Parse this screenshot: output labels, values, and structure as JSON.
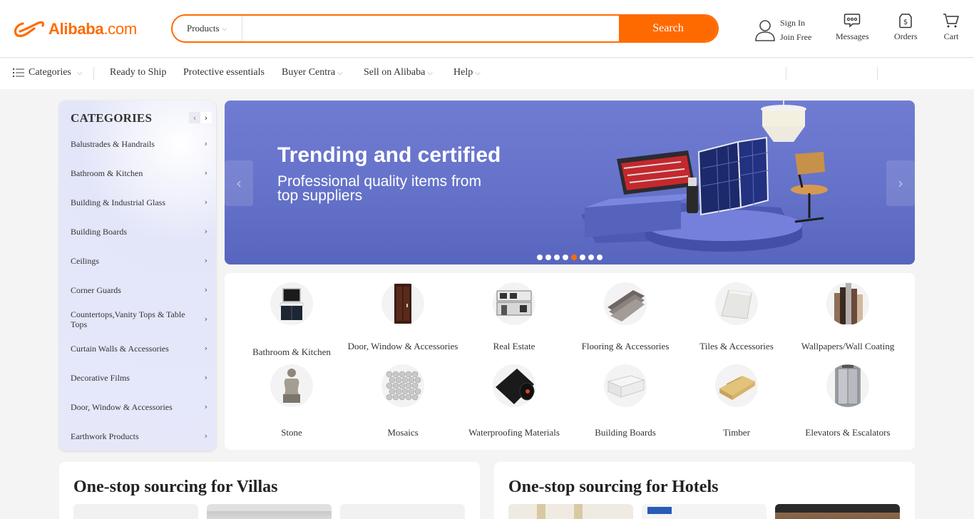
{
  "brand": {
    "name": "Alibaba",
    "suffix": ".com",
    "color": "#ff6a00"
  },
  "search": {
    "type_label": "Products",
    "placeholder": "",
    "button_label": "Search"
  },
  "account": {
    "sign_in": "Sign In",
    "join": "Join Free"
  },
  "header_items": {
    "messages": "Messages",
    "orders": "Orders",
    "cart": "Cart"
  },
  "nav": {
    "categories": "Categories",
    "ready_to_ship": "Ready to Ship",
    "protective": "Protective essentials",
    "buyer_central": "Buyer Centra",
    "sell": "Sell on Alibaba",
    "help": "Help"
  },
  "categories_panel": {
    "title": "CATEGORIES",
    "items": [
      "Balustrades & Handrails",
      "Bathroom & Kitchen",
      "Building & Industrial Glass",
      "Building Boards",
      "Ceilings",
      "Corner Guards",
      "Countertops,Vanity Tops & Table Tops",
      "Curtain Walls & Accessories",
      "Decorative Films",
      "Door, Window & Accessories",
      "Earthwork Products"
    ]
  },
  "banner": {
    "title": "Trending and certified",
    "subtitle": "Professional quality items from top suppliers",
    "slides": 8,
    "active_slide": 5
  },
  "quick_categories": [
    {
      "label": "Bathroom & Kitchen",
      "icon": "vanity-icon"
    },
    {
      "label": "Door, Window & Accessories",
      "icon": "door-icon"
    },
    {
      "label": "Real Estate",
      "icon": "building-icon"
    },
    {
      "label": "Flooring & Accessories",
      "icon": "flooring-icon"
    },
    {
      "label": "Tiles & Accessories",
      "icon": "tile-icon"
    },
    {
      "label": "Wallpapers/Wall Coating",
      "icon": "wallpaper-rolls-icon"
    },
    {
      "label": "Stone",
      "icon": "statue-icon"
    },
    {
      "label": "Mosaics",
      "icon": "mosaic-icon"
    },
    {
      "label": "Waterproofing Materials",
      "icon": "membrane-roll-icon"
    },
    {
      "label": "Building Boards",
      "icon": "board-icon"
    },
    {
      "label": "Timber",
      "icon": "timber-icon"
    },
    {
      "label": "Elevators & Escalators",
      "icon": "elevator-icon"
    }
  ],
  "sourcing_cards": [
    {
      "title": "One-stop sourcing for Villas"
    },
    {
      "title": "One-stop sourcing for Hotels"
    }
  ]
}
